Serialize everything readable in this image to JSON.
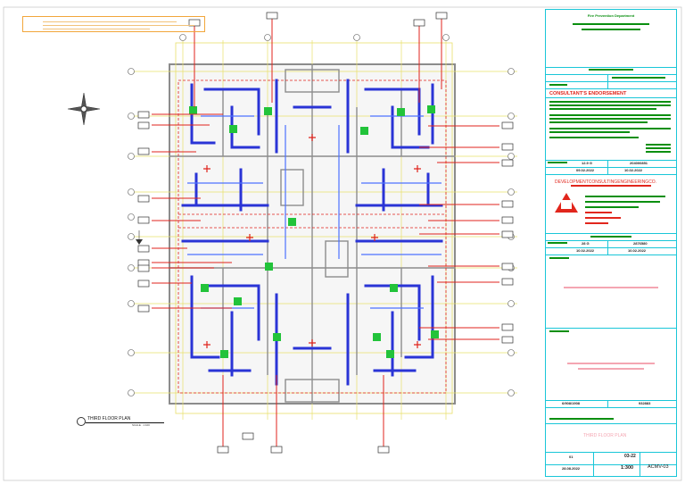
{
  "title_block": {
    "department": "Fire Prevention Department",
    "consultant_heading": "CONSULTANT'S ENDORSEMENT",
    "consultant_name": "DEVELOPMENTCONSULTINGENGINEERINGCO.",
    "reg_no_1": "12.9 G",
    "reg_no_2": "28 G",
    "date_1": "09.02.2022",
    "date_2": "10.02.2022",
    "date_3": "10.02.2022",
    "date_4": "10.02.2022",
    "code_1": "204000851",
    "code_2": "2876580",
    "scale": "1:300",
    "sheet_code": "ACMV-03",
    "sheet_no": "03-22",
    "rev": "01",
    "rev_date": "28.08.2022",
    "drawing_title": "THIRD FLOOR PLAN",
    "plot_no": "6/908/1908",
    "mark": "932883"
  },
  "plan": {
    "title": "THIRD FLOOR PLAN",
    "scale_note": "SCALE : 1:100"
  },
  "colors": {
    "border": "#19c6d8",
    "duct_blue": "#2a34d6",
    "pipe_red": "#e0231c",
    "equipment_green": "#22c33a",
    "grid_yellow": "#e8e06a",
    "wall_gray": "#8c8c8c"
  }
}
